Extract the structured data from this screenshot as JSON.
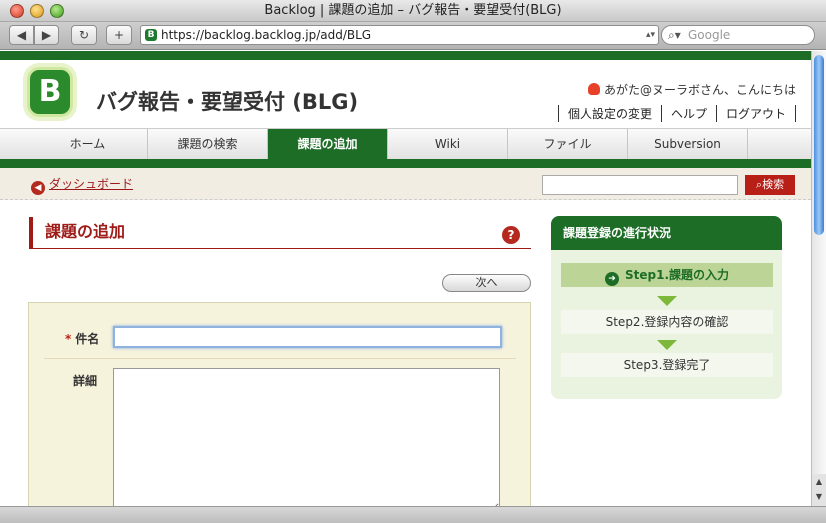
{
  "window": {
    "title": "Backlog | 課題の追加 – バグ報告・要望受付(BLG)"
  },
  "toolbar": {
    "back_icon": "◀",
    "forward_icon": "▶",
    "reload_icon": "↻",
    "add_icon": "+",
    "url": "https://backlog.backlog.jp/add/BLG",
    "search_placeholder": "Google"
  },
  "header": {
    "logo_letter": "B",
    "project_title": "バグ報告・要望受付 (BLG)",
    "greeting": "あがた@ヌーラボさん、こんにちは",
    "links": [
      "個人設定の変更",
      "ヘルプ",
      "ログアウト"
    ]
  },
  "nav": {
    "tabs": [
      {
        "label": "ホーム"
      },
      {
        "label": "課題の検索"
      },
      {
        "label": "課題の追加"
      },
      {
        "label": "Wiki"
      },
      {
        "label": "ファイル"
      },
      {
        "label": "Subversion"
      }
    ],
    "active_index": 2
  },
  "subbar": {
    "dashboard_link": "ダッシュボード",
    "search_button": "検索",
    "search_value": ""
  },
  "main": {
    "title": "課題の追加",
    "help_icon": "?",
    "next_button": "次へ",
    "form": {
      "required_mark": "*",
      "subject_label": "件名",
      "subject_value": "",
      "detail_label": "詳細",
      "detail_value": ""
    }
  },
  "progress": {
    "title": "課題登録の進行状況",
    "steps": [
      {
        "label": "Step1.課題の入力"
      },
      {
        "label": "Step2.登録内容の確認"
      },
      {
        "label": "Step3.登録完了"
      }
    ],
    "current_step": 1
  },
  "colors": {
    "brand_green": "#1d6d27",
    "accent_red": "#9e1b17"
  }
}
